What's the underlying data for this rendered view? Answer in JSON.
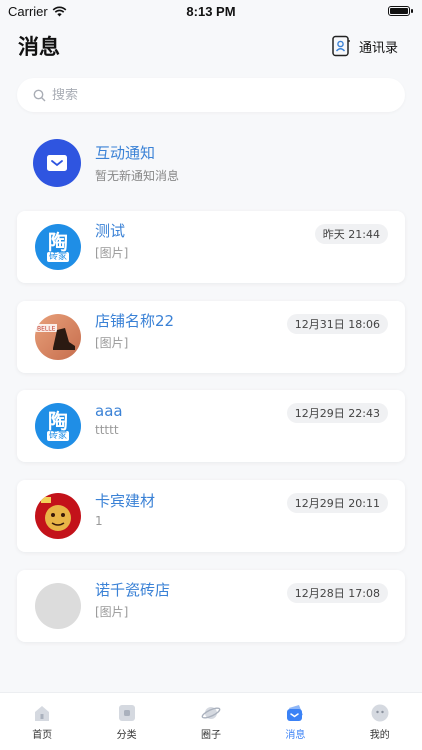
{
  "status_bar": {
    "carrier": "Carrier",
    "time": "8:13 PM"
  },
  "header": {
    "title": "消息",
    "contacts_label": "通讯录"
  },
  "search": {
    "placeholder": "搜索"
  },
  "notice": {
    "title": "互动通知",
    "subtitle": "暂无新通知消息"
  },
  "conversations": [
    {
      "name": "测试",
      "message": "[图片]",
      "time": "昨天 21:44",
      "avatar": "tao",
      "avatar_text": "陶",
      "avatar_sub": "砖家"
    },
    {
      "name": "店铺名称22",
      "message": "[图片]",
      "time": "12月31日 18:06",
      "avatar": "belle",
      "avatar_text": "BELLE"
    },
    {
      "name": "aaa",
      "message": "ttttt",
      "time": "12月29日 22:43",
      "avatar": "tao",
      "avatar_text": "陶",
      "avatar_sub": "砖家"
    },
    {
      "name": "卡宾建材",
      "message": "1",
      "time": "12月29日 20:11",
      "avatar": "tiger"
    },
    {
      "name": "诺千瓷砖店",
      "message": "[图片]",
      "time": "12月28日 17:08",
      "avatar": "gray"
    }
  ],
  "tabbar": {
    "active_index": 3,
    "tabs": [
      {
        "label": "首页",
        "icon": "home-icon"
      },
      {
        "label": "分类",
        "icon": "category-icon"
      },
      {
        "label": "圈子",
        "icon": "planet-icon"
      },
      {
        "label": "消息",
        "icon": "message-icon"
      },
      {
        "label": "我的",
        "icon": "profile-icon"
      }
    ]
  },
  "colors": {
    "accent": "#3b82d6",
    "notice_avatar": "#2f55e0",
    "background": "#f7f8fa"
  }
}
